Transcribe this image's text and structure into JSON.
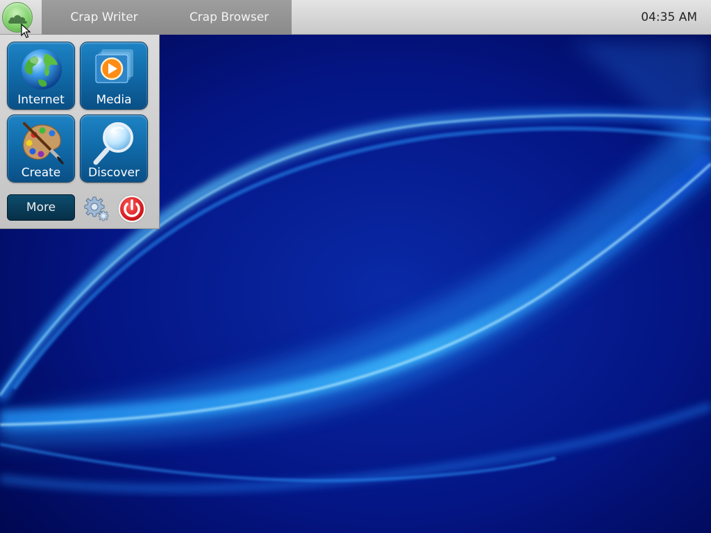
{
  "colors": {
    "panel": "#d6d6d6",
    "taskbar": "#959595",
    "tile_blue": "#106aa8",
    "more_button": "#0a3d5a",
    "start_orb": "#7fd06a",
    "power_red": "#e0141e",
    "wallpaper_dark": "#00064a",
    "wallpaper_light": "#37b6ff"
  },
  "panel": {
    "start_icon": "cloud-orb-icon",
    "tasks": [
      {
        "label": "Crap Writer"
      },
      {
        "label": "Crap Browser"
      }
    ],
    "clock": "04:35 AM"
  },
  "launcher": {
    "tiles": [
      {
        "label": "Internet",
        "icon": "globe-icon"
      },
      {
        "label": "Media",
        "icon": "media-play-icon"
      },
      {
        "label": "Create",
        "icon": "paint-palette-icon"
      },
      {
        "label": "Discover",
        "icon": "magnifier-icon"
      }
    ],
    "more_label": "More",
    "settings_icon": "gear-icon",
    "power_icon": "power-icon"
  }
}
